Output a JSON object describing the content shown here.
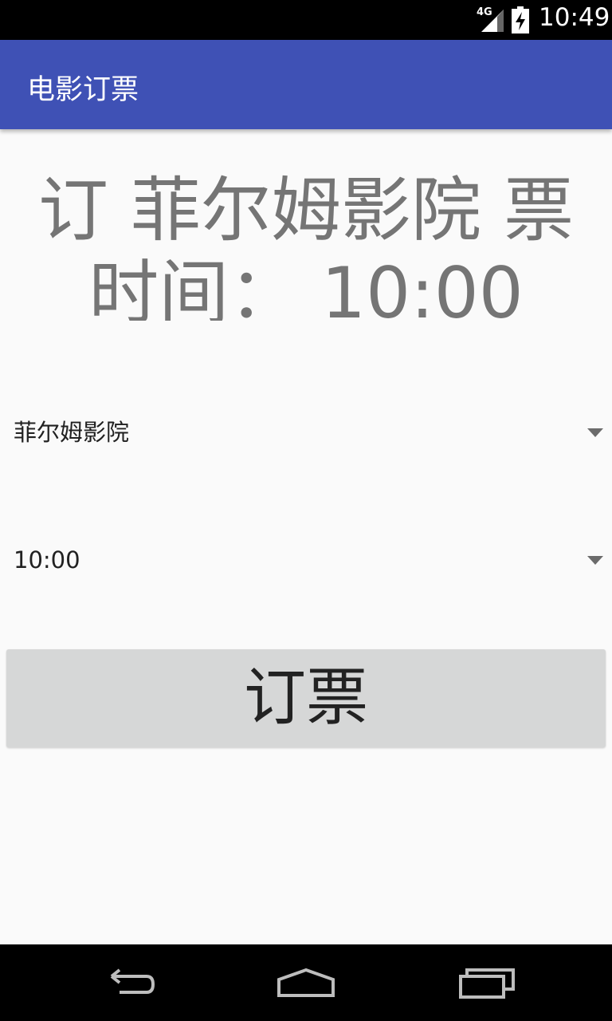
{
  "status_bar": {
    "network_label": "4G",
    "time": "10:49",
    "icons": [
      "signal-icon",
      "battery-charging-icon"
    ]
  },
  "app_bar": {
    "title": "电影订票"
  },
  "headline": {
    "line1": "订 菲尔姆影院 票",
    "line2": "时间： 10:00"
  },
  "cinema_spinner": {
    "selected": "菲尔姆影院"
  },
  "time_spinner": {
    "selected": "10:00"
  },
  "book_button": {
    "label": "订票"
  },
  "nav_bar": {
    "icons": [
      "back-icon",
      "home-icon",
      "recents-icon"
    ]
  },
  "colors": {
    "app_bar": "#3f51b5",
    "background": "#fafafa",
    "headline_text": "#757575",
    "button_bg": "#d6d7d7"
  }
}
